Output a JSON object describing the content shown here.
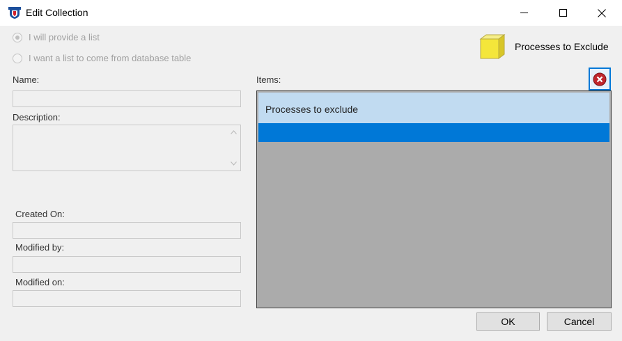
{
  "window": {
    "title": "Edit Collection"
  },
  "source_options": {
    "provide_list_label": "I will provide a list",
    "provide_list_selected": true,
    "from_table_label": "I want a list to come from database table",
    "from_table_selected": false
  },
  "form": {
    "name_label": "Name:",
    "name_value": "",
    "description_label": "Description:",
    "description_value": "",
    "created_on_label": "Created On:",
    "created_on_value": "",
    "modified_by_label": "Modified by:",
    "modified_by_value": "",
    "modified_on_label": "Modified on:",
    "modified_on_value": ""
  },
  "collection": {
    "name": "Processes to Exclude",
    "icon": "yellow-cube-icon"
  },
  "items": {
    "label": "Items:",
    "rows": [
      "Processes to exclude",
      ""
    ],
    "remove_icon": "remove-icon"
  },
  "buttons": {
    "ok": "OK",
    "cancel": "Cancel"
  },
  "colors": {
    "selection": "#0078d7",
    "highlight": "#c1dbf1",
    "list_background": "#ababab"
  }
}
